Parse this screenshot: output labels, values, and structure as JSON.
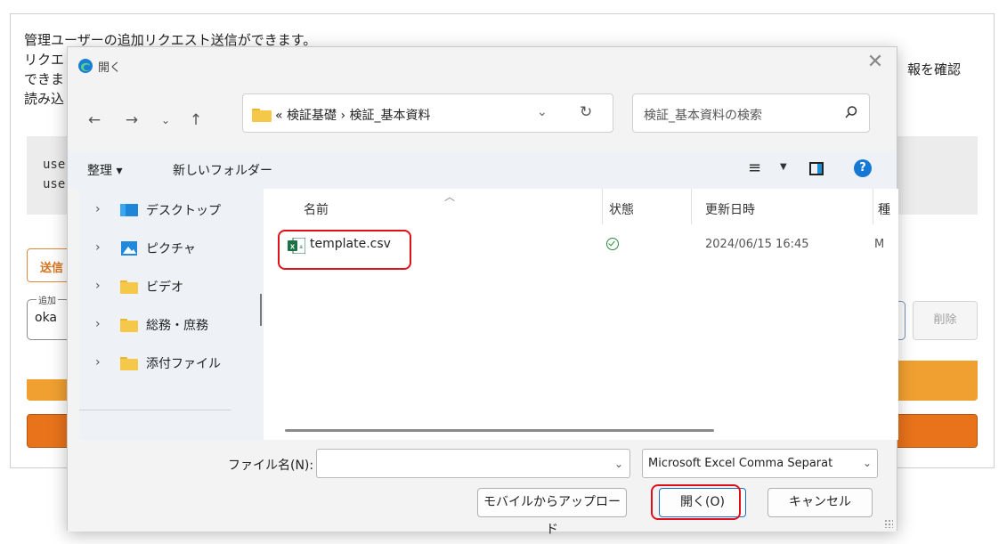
{
  "background_page": {
    "line1": "管理ユーザーの追加リクエスト送信ができます。",
    "line2": "リクエ",
    "line3": "できま",
    "line4": "読み込",
    "right_text": "報を確認",
    "gray_line1": "use",
    "gray_line2": "use",
    "send_label": "送信",
    "field_label": "追加",
    "field_value": "oka",
    "delete_label": "削除"
  },
  "dialog": {
    "title": "開く",
    "address": {
      "path": "« 検証基礎 › 検証_基本資料"
    },
    "search_placeholder": "検証_基本資料の検索",
    "toolbar": {
      "organize": "整理 ▾",
      "new_folder": "新しいフォルダー"
    },
    "nav_items": [
      {
        "label": "デスクトップ",
        "icon": "desktop-icon"
      },
      {
        "label": "ピクチャ",
        "icon": "pictures-icon"
      },
      {
        "label": "ビデオ",
        "icon": "folder-icon"
      },
      {
        "label": "総務・庶務",
        "icon": "folder-icon"
      },
      {
        "label": "添付ファイル",
        "icon": "folder-icon"
      }
    ],
    "columns": {
      "name": "名前",
      "status": "状態",
      "modified": "更新日時",
      "type": "種"
    },
    "files": [
      {
        "name": "template.csv",
        "status": "synced",
        "modified": "2024/06/15 16:45",
        "type": "M",
        "icon": "excel-csv-icon"
      }
    ],
    "filename_label": "ファイル名(N):",
    "filename_value": "",
    "filetype": "Microsoft Excel Comma Separat",
    "buttons": {
      "mobile": "モバイルからアップロード",
      "open": "開く(O)",
      "cancel": "キャンセル"
    }
  }
}
